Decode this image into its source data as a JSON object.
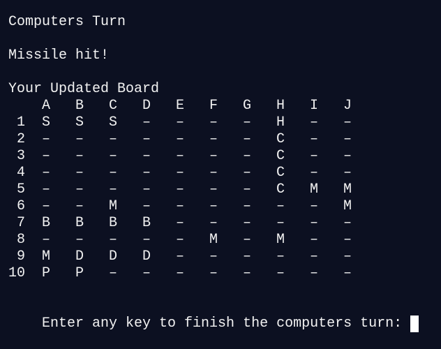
{
  "terminal": {
    "heading": "Computers Turn",
    "status": "Missile hit!",
    "board_title": "Your Updated Board",
    "prompt": "Enter any key to finish the computers turn:"
  },
  "board": {
    "columns": [
      "A",
      "B",
      "C",
      "D",
      "E",
      "F",
      "G",
      "H",
      "I",
      "J"
    ],
    "rows": [
      {
        "label": "1",
        "cells": [
          "S",
          "S",
          "S",
          "–",
          "–",
          "–",
          "–",
          "H",
          "–",
          "–"
        ]
      },
      {
        "label": "2",
        "cells": [
          "–",
          "–",
          "–",
          "–",
          "–",
          "–",
          "–",
          "C",
          "–",
          "–"
        ]
      },
      {
        "label": "3",
        "cells": [
          "–",
          "–",
          "–",
          "–",
          "–",
          "–",
          "–",
          "C",
          "–",
          "–"
        ]
      },
      {
        "label": "4",
        "cells": [
          "–",
          "–",
          "–",
          "–",
          "–",
          "–",
          "–",
          "C",
          "–",
          "–"
        ]
      },
      {
        "label": "5",
        "cells": [
          "–",
          "–",
          "–",
          "–",
          "–",
          "–",
          "–",
          "C",
          "M",
          "M"
        ]
      },
      {
        "label": "6",
        "cells": [
          "–",
          "–",
          "M",
          "–",
          "–",
          "–",
          "–",
          "–",
          "–",
          "M"
        ]
      },
      {
        "label": "7",
        "cells": [
          "B",
          "B",
          "B",
          "B",
          "–",
          "–",
          "–",
          "–",
          "–",
          "–"
        ]
      },
      {
        "label": "8",
        "cells": [
          "–",
          "–",
          "–",
          "–",
          "–",
          "M",
          "–",
          "M",
          "–",
          "–"
        ]
      },
      {
        "label": "9",
        "cells": [
          "M",
          "D",
          "D",
          "D",
          "–",
          "–",
          "–",
          "–",
          "–",
          "–"
        ]
      },
      {
        "label": "10",
        "cells": [
          "P",
          "P",
          "–",
          "–",
          "–",
          "–",
          "–",
          "–",
          "–",
          "–"
        ]
      }
    ]
  }
}
